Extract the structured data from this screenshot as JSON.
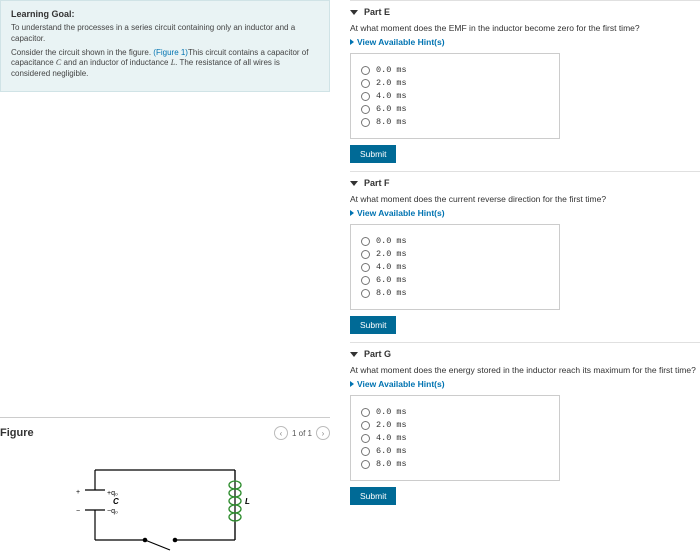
{
  "learning_goal": {
    "title": "Learning Goal:",
    "line1": "To understand the processes in a series circuit containing only an inductor and a capacitor.",
    "line2_a": "Consider the circuit shown in the figure. ",
    "line2_link": "(Figure 1)",
    "line2_b": "This circuit contains a capacitor of capacitance ",
    "varC": "C",
    "line2_c": " and an inductor of inductance ",
    "varL": "L",
    "line2_d": ". The resistance of all wires is considered negligible."
  },
  "figure": {
    "title": "Figure",
    "nav_prev": "‹",
    "counter": "1 of 1",
    "nav_next": "›",
    "label_qplus": "+q",
    "label_qminus": "−q",
    "label_C": "C",
    "label_L": "L"
  },
  "hints_label": "View Available Hint(s)",
  "submit_label": "Submit",
  "options": [
    "0.0 ms",
    "2.0 ms",
    "4.0 ms",
    "6.0 ms",
    "8.0 ms"
  ],
  "parts": {
    "E": {
      "title": "Part E",
      "question": "At what moment does the EMF in the inductor become zero for the first time?"
    },
    "F": {
      "title": "Part F",
      "question": "At what moment does the current reverse direction for the first time?"
    },
    "G": {
      "title": "Part G",
      "question": "At what moment does the energy stored in the inductor reach its maximum for the first time?"
    }
  }
}
